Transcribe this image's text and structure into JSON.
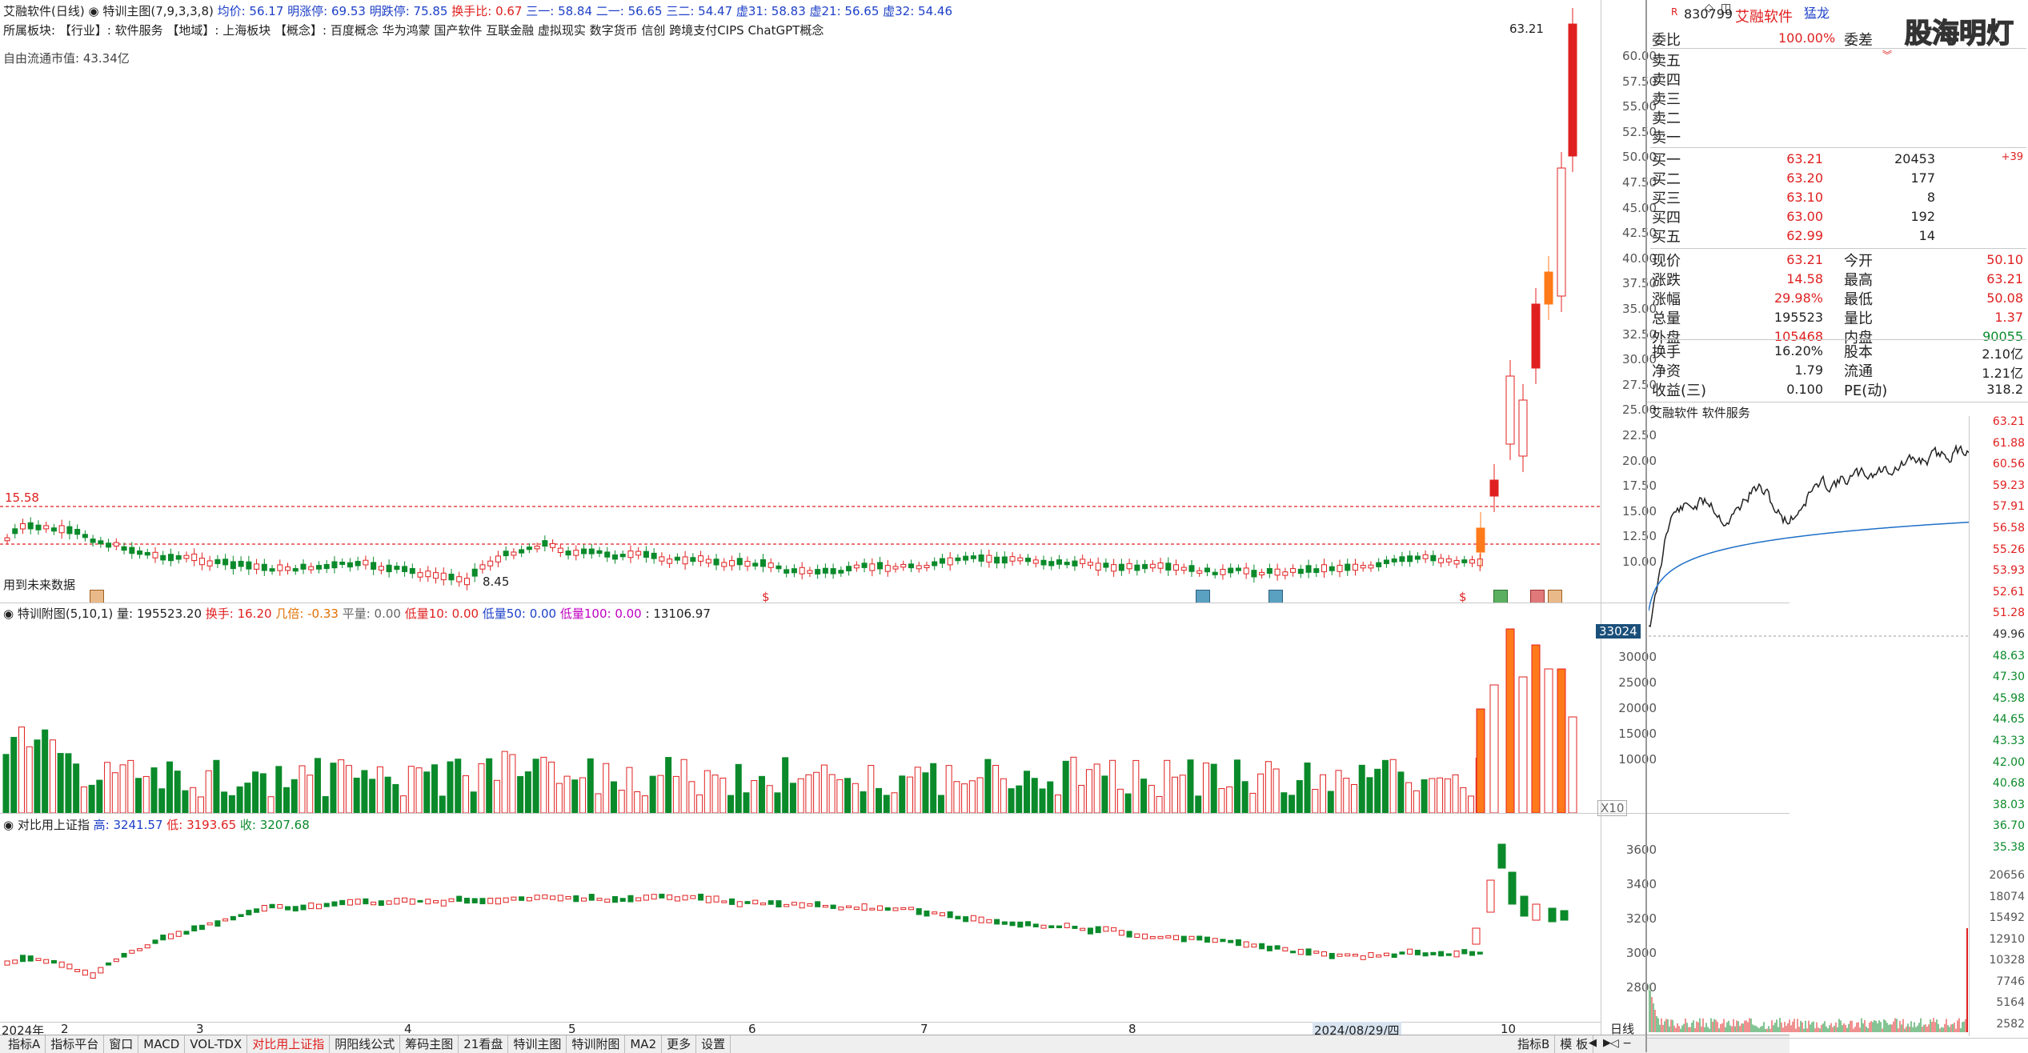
{
  "header": {
    "line1": [
      {
        "text": "艾融软件(日线)",
        "cls": ""
      },
      {
        "text": "特训主图(7,9,3,3,8)",
        "cls": ""
      },
      {
        "text": "均价: 56.17",
        "cls": "blue"
      },
      {
        "text": "明涨停: 69.53",
        "cls": "blue"
      },
      {
        "text": "明跌停: 75.85",
        "cls": "blue"
      },
      {
        "text": "换手比: 0.67",
        "cls": "red"
      },
      {
        "text": "三一: 58.84",
        "cls": "blue"
      },
      {
        "text": "二一: 56.65",
        "cls": "blue"
      },
      {
        "text": "三二: 54.47",
        "cls": "blue"
      },
      {
        "text": "虚31: 58.83",
        "cls": "blue"
      },
      {
        "text": "虚21: 56.65",
        "cls": "blue"
      },
      {
        "text": "虚32: 54.46",
        "cls": "blue"
      }
    ],
    "line2": "所属板块: 【行业】: 软件服务      【地域】: 上海板块      【概念】: 百度概念 华为鸿蒙 国产软件 互联金融 虚拟现实 数字货币 信创 跨境支付CIPS ChatGPT概念",
    "line3": "自由流通市值: 43.34亿",
    "future_label": "用到未来数据",
    "high_marker": "63.21",
    "level_marker": "15.58",
    "low_marker": "8.45"
  },
  "price_axis": [
    "60.00",
    "57.50",
    "55.00",
    "52.50",
    "50.00",
    "47.50",
    "45.00",
    "42.50",
    "40.00",
    "37.50",
    "35.00",
    "32.50",
    "30.00",
    "27.50",
    "25.00",
    "22.50",
    "20.00",
    "17.50",
    "15.00",
    "12.50",
    "10.00"
  ],
  "volume_panel": {
    "title": "特训附图(5,10,1)",
    "items": [
      {
        "text": "量: 195523.20",
        "cls": ""
      },
      {
        "text": "换手: 16.20",
        "cls": "red"
      },
      {
        "text": "几倍: -0.33",
        "cls": "orange"
      },
      {
        "text": "平量: 0.00",
        "cls": "gray"
      },
      {
        "text": "低量10: 0.00",
        "cls": "red"
      },
      {
        "text": "低量50: 0.00",
        "cls": "blue"
      },
      {
        "text": "低量100: 0.00",
        "cls": "magenta"
      },
      {
        "text": ": 13106.97",
        "cls": ""
      }
    ],
    "axis": [
      "30000",
      "25000",
      "20000",
      "15000",
      "10000"
    ],
    "badge": "33024",
    "unit": "X10"
  },
  "index_panel": {
    "title": "对比用上证指",
    "items": [
      {
        "text": "高: 3241.57",
        "cls": "blue"
      },
      {
        "text": "低: 3193.65",
        "cls": "red"
      },
      {
        "text": "收: 3207.68",
        "cls": "green"
      }
    ],
    "axis": [
      "3600",
      "3400",
      "3200",
      "3000",
      "2800"
    ]
  },
  "x_axis": {
    "labels": [
      {
        "text": "2024年"
      },
      {
        "text": "2"
      },
      {
        "text": "3"
      },
      {
        "text": "4"
      },
      {
        "text": "5"
      },
      {
        "text": "6"
      },
      {
        "text": "7"
      },
      {
        "text": "8"
      },
      {
        "text": "10"
      }
    ],
    "cursor_date": "2024/08/29/四"
  },
  "bottom_tabs": [
    "指标A",
    "指标平台",
    "窗口",
    "MACD",
    "VOL-TDX",
    "对比用上证指",
    "阴阳线公式",
    "筹码主图",
    "21看盘",
    "特训主图",
    "特训附图",
    "MA2",
    "更多",
    "设置"
  ],
  "bottom_right_tabs": [
    "指标B",
    "模 板"
  ],
  "right_panel": {
    "code": "830799",
    "name": "艾融软件",
    "tag": "猛龙",
    "watermark": "股海明灯",
    "weibi_label": "委比",
    "weibi_value": "100.00%",
    "weicha_label": "委差",
    "asks": [
      {
        "label": "卖五",
        "price": "",
        "vol": ""
      },
      {
        "label": "卖四",
        "price": "",
        "vol": ""
      },
      {
        "label": "卖三",
        "price": "",
        "vol": ""
      },
      {
        "label": "卖二",
        "price": "",
        "vol": ""
      },
      {
        "label": "卖一",
        "price": "",
        "vol": ""
      }
    ],
    "bids": [
      {
        "label": "买一",
        "price": "63.21",
        "vol": "20453",
        "chg": "+39"
      },
      {
        "label": "买二",
        "price": "63.20",
        "vol": "177",
        "chg": ""
      },
      {
        "label": "买三",
        "price": "63.10",
        "vol": "8",
        "chg": ""
      },
      {
        "label": "买四",
        "price": "63.00",
        "vol": "192",
        "chg": ""
      },
      {
        "label": "买五",
        "price": "62.99",
        "vol": "14",
        "chg": ""
      }
    ],
    "quote": [
      {
        "l1": "现价",
        "v1": "63.21",
        "c1": "red",
        "l2": "今开",
        "v2": "50.10",
        "c2": "red"
      },
      {
        "l1": "涨跌",
        "v1": "14.58",
        "c1": "red",
        "l2": "最高",
        "v2": "63.21",
        "c2": "red"
      },
      {
        "l1": "涨幅",
        "v1": "29.98%",
        "c1": "red",
        "l2": "最低",
        "v2": "50.08",
        "c2": "red"
      },
      {
        "l1": "总量",
        "v1": "195523",
        "c1": "",
        "l2": "量比",
        "v2": "1.37",
        "c2": "red"
      },
      {
        "l1": "外盘",
        "v1": "105468",
        "c1": "red",
        "l2": "内盘",
        "v2": "90055",
        "c2": "green"
      }
    ],
    "fundamentals": [
      {
        "l1": "换手",
        "v1": "16.20%",
        "l2": "股本",
        "v2": "2.10亿"
      },
      {
        "l1": "净资",
        "v1": "1.79",
        "l2": "流通",
        "v2": "1.21亿"
      },
      {
        "l1": "收益(三)",
        "v1": "0.100",
        "l2": "PE(动)",
        "v2": "318.2"
      }
    ],
    "mini_title": "艾融软件  软件服务",
    "mini_price_axis": [
      "63.21",
      "61.88",
      "60.56",
      "59.23",
      "57.91",
      "56.58",
      "55.26",
      "53.93",
      "52.61",
      "51.28",
      "49.96",
      "48.63",
      "47.30",
      "45.98",
      "44.65",
      "43.33",
      "42.00",
      "40.68",
      "38.03",
      "36.70",
      "35.38"
    ],
    "mini_vol_axis": [
      "20656",
      "18074",
      "15492",
      "12910",
      "10328",
      "7746",
      "5164",
      "2582"
    ],
    "bottom_label": "日线"
  },
  "colors": {
    "up": "#e02020",
    "down": "#0a8a2a",
    "orange": "#ff7a1a",
    "blue": "#1e40c8",
    "grid": "#d0d0d0"
  }
}
